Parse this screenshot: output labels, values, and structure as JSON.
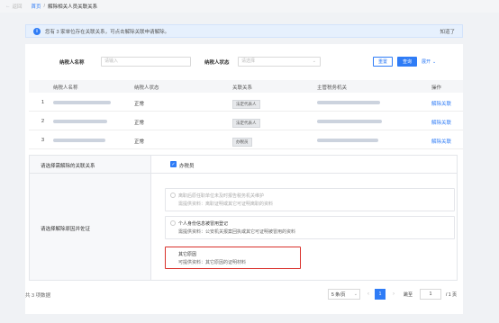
{
  "topbar": {
    "back_label": "返回",
    "breadcrumb_home": "首页",
    "breadcrumb_sep": "/",
    "breadcrumb_current": "解除相关人员关联关系"
  },
  "notice": {
    "icon": "info-icon",
    "message": "您有 3 家单位存在关联关系，可点击解除关联申请解除。",
    "ok_label": "知道了"
  },
  "filter": {
    "name_label": "纳税人名称",
    "name_placeholder": "请输入",
    "status_label": "纳税人状态",
    "status_placeholder": "请选择",
    "reset_label": "重置",
    "query_label": "查询",
    "expand_label": "展开"
  },
  "table": {
    "columns": [
      "纳税人名称",
      "纳税人状态",
      "关联关系",
      "主管税务机关",
      "操作"
    ],
    "rows": [
      {
        "index": "1",
        "status": "正常",
        "relation": "法定代表人",
        "action": "解除关联"
      },
      {
        "index": "2",
        "status": "正常",
        "relation": "法定代表人",
        "action": "解除关联"
      },
      {
        "index": "3",
        "status": "正常",
        "relation": "办税员",
        "action": "解除关联"
      }
    ]
  },
  "panel": {
    "select_label": "请选择需解除的关联关系",
    "selected_option": "办税员",
    "reason_label": "请选择解除原因并佐证",
    "options": [
      {
        "title": "离职后原任职单位未及时报告税务机关维护",
        "desc": "需提供资料：离职证明或其它可证明离职的资料"
      },
      {
        "title": "个人身份信息被冒用登记",
        "desc": "需提供资料：公安机关报案回执或其它可证明被冒用的资料"
      },
      {
        "title": "其它原因",
        "desc": "可提供资料：其它原因的证明材料"
      }
    ]
  },
  "footer": {
    "total": "共 3 项数据",
    "page_size": "5 条/页",
    "current_page": "1",
    "goto_label": "跳至",
    "goto_value": "1",
    "total_pages": "/ 1 页"
  },
  "colors": {
    "primary": "#2f7cf6",
    "highlight_border": "#d9302a"
  }
}
